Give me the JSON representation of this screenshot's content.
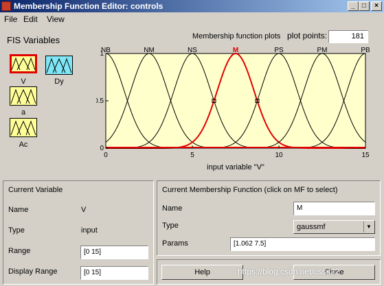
{
  "window": {
    "title": "Membership Function Editor: controls",
    "controls": [
      "_",
      "□",
      "×"
    ]
  },
  "menu": [
    "File",
    "Edit",
    "View"
  ],
  "fis": {
    "label": "FIS Variables",
    "variables": [
      {
        "name": "V",
        "kind": "input",
        "selected": true
      },
      {
        "name": "Dy",
        "kind": "output",
        "selected": false
      },
      {
        "name": "a",
        "kind": "input",
        "selected": false
      },
      {
        "name": "Ac",
        "kind": "input",
        "selected": false
      }
    ]
  },
  "plot_header": {
    "title": "Membership function plots",
    "points_label": "plot points:",
    "points_value": "181"
  },
  "chart_data": {
    "type": "line",
    "xlabel": "input variable \"V\"",
    "xlim": [
      0,
      15
    ],
    "ylim": [
      0,
      1
    ],
    "xticks": [
      0,
      5,
      10,
      15
    ],
    "yticks": [
      0,
      0.5,
      1
    ],
    "series": [
      {
        "name": "NB",
        "sigma": 1.062,
        "center": 0,
        "highlight": false
      },
      {
        "name": "NM",
        "sigma": 1.062,
        "center": 2.5,
        "highlight": false
      },
      {
        "name": "NS",
        "sigma": 1.062,
        "center": 5,
        "highlight": false
      },
      {
        "name": "M",
        "sigma": 1.062,
        "center": 7.5,
        "highlight": true
      },
      {
        "name": "PS",
        "sigma": 1.062,
        "center": 10,
        "highlight": false
      },
      {
        "name": "PM",
        "sigma": 1.062,
        "center": 12.5,
        "highlight": false
      },
      {
        "name": "PB",
        "sigma": 1.062,
        "center": 15,
        "highlight": false
      }
    ],
    "background": "#ffffcc",
    "highlight_color": "#e00000"
  },
  "current_variable": {
    "title": "Current Variable",
    "name_label": "Name",
    "name_value": "V",
    "type_label": "Type",
    "type_value": "input",
    "range_label": "Range",
    "range_value": "[0 15]",
    "display_range_label": "Display Range",
    "display_range_value": "[0 15]"
  },
  "current_mf": {
    "title": "Current Membership Function (click on MF to select)",
    "name_label": "Name",
    "name_value": "M",
    "type_label": "Type",
    "type_value": "gaussmf",
    "params_label": "Params",
    "params_value": "[1.062 7.5]"
  },
  "buttons": {
    "help": "Help",
    "close": "Close"
  },
  "watermark": "https://blog.csdn.net/csss22"
}
